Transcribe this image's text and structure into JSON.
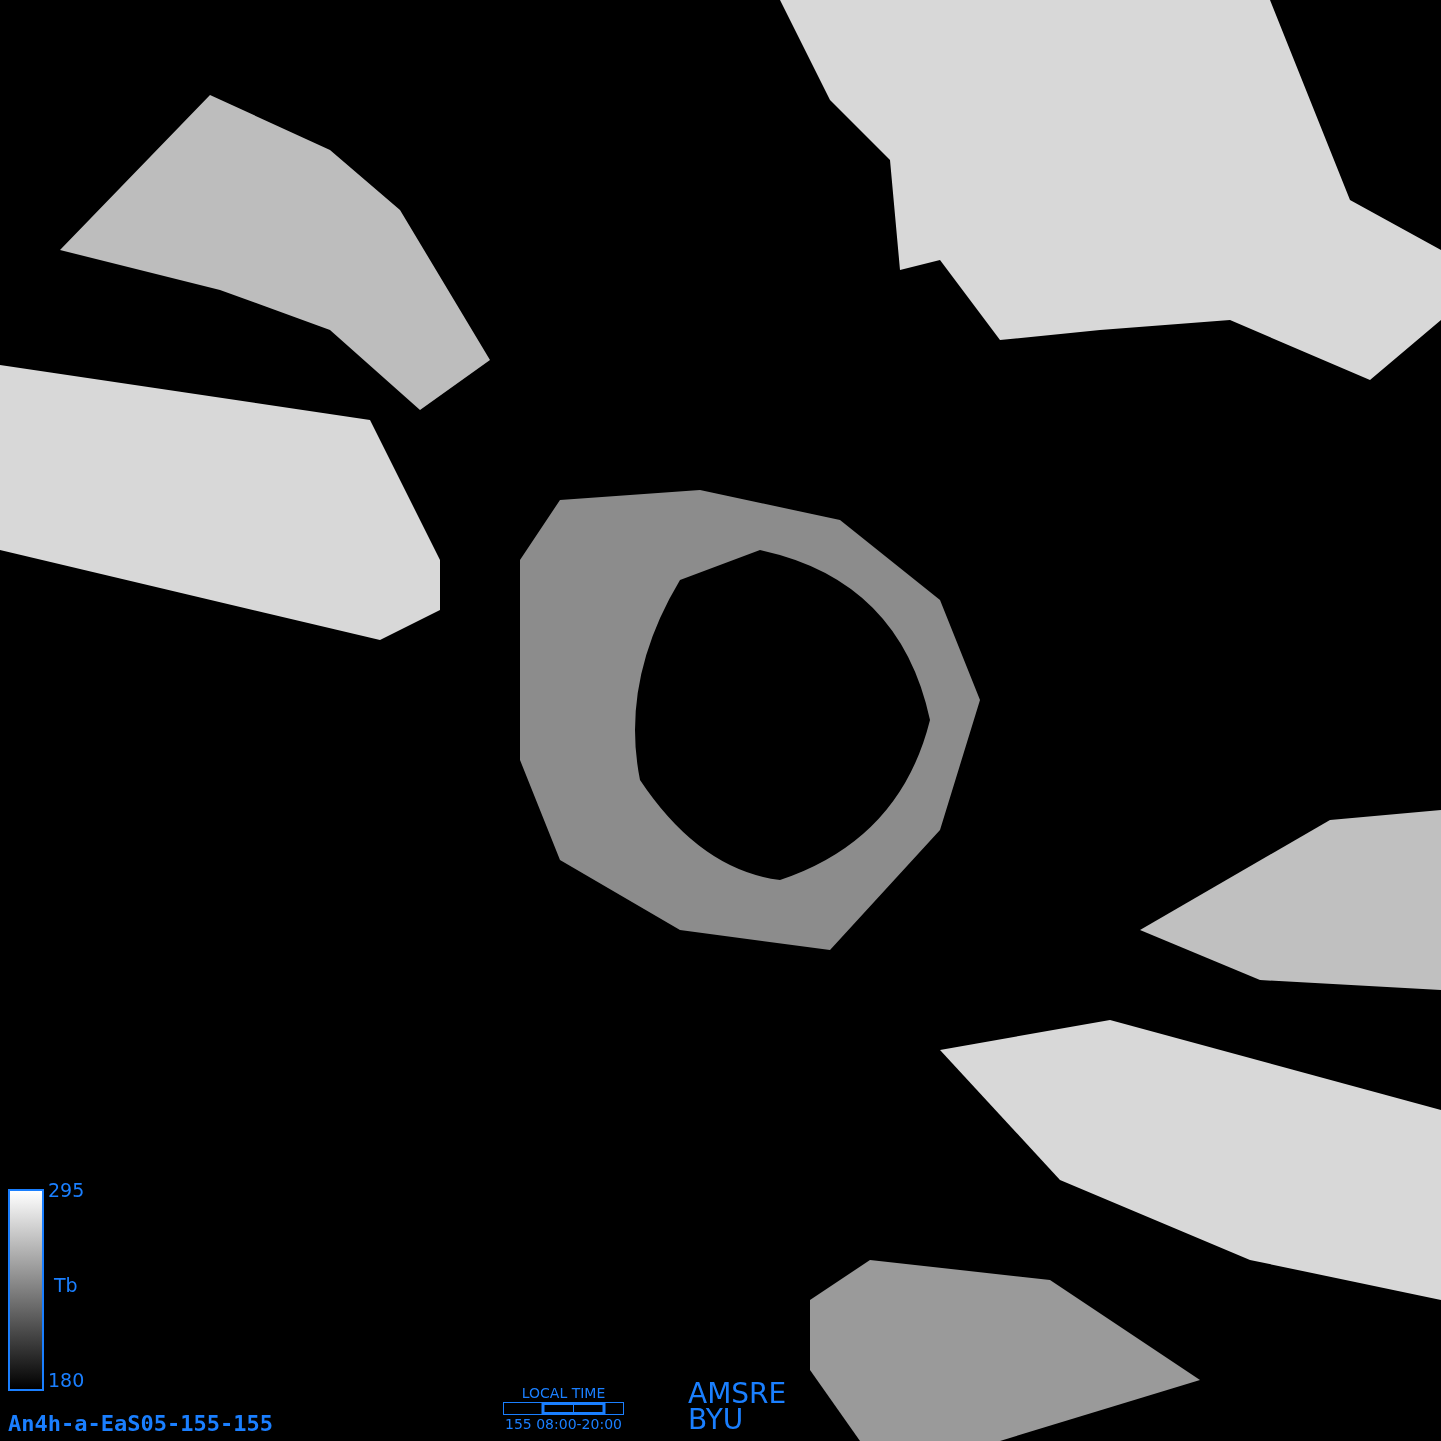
{
  "colorbar": {
    "max_label": "295",
    "quantity_label": "Tb",
    "min_label": "180"
  },
  "image_id": "An4h-a-EaS05-155-155",
  "local_time": {
    "title": "LOCAL TIME",
    "range": "155 08:00-20:00"
  },
  "credits": [
    "AMSRE",
    "BYU"
  ]
}
